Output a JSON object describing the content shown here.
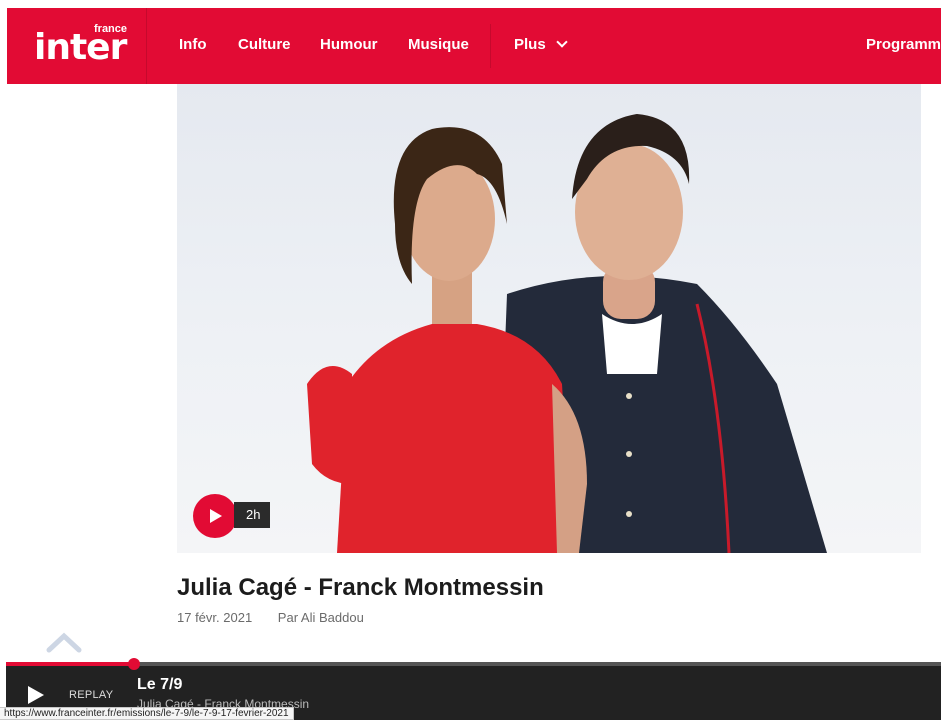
{
  "header": {
    "logo_main": "inter",
    "logo_sup": "france",
    "nav": [
      "Info",
      "Culture",
      "Humour",
      "Musique"
    ],
    "plus_label": "Plus",
    "programme_label": "Programme",
    "brand_color": "#e20b34"
  },
  "episode": {
    "duration": "2h",
    "title": "Julia Cagé - Franck Montmessin",
    "date": "17 févr. 2021",
    "byline": "Par  Ali Baddou"
  },
  "player": {
    "replay_label": "REPLAY",
    "title": "Le 7/9",
    "subtitle": "Julia Cagé - Franck Montmessin",
    "progress_fraction": 0.137
  },
  "status_url": "https://www.franceinter.fr/emissions/le-7-9/le-7-9-17-fevrier-2021",
  "icons": {
    "play": "play-icon",
    "chevron": "chevron-down-icon",
    "scroll_top": "chevron-up-icon"
  }
}
